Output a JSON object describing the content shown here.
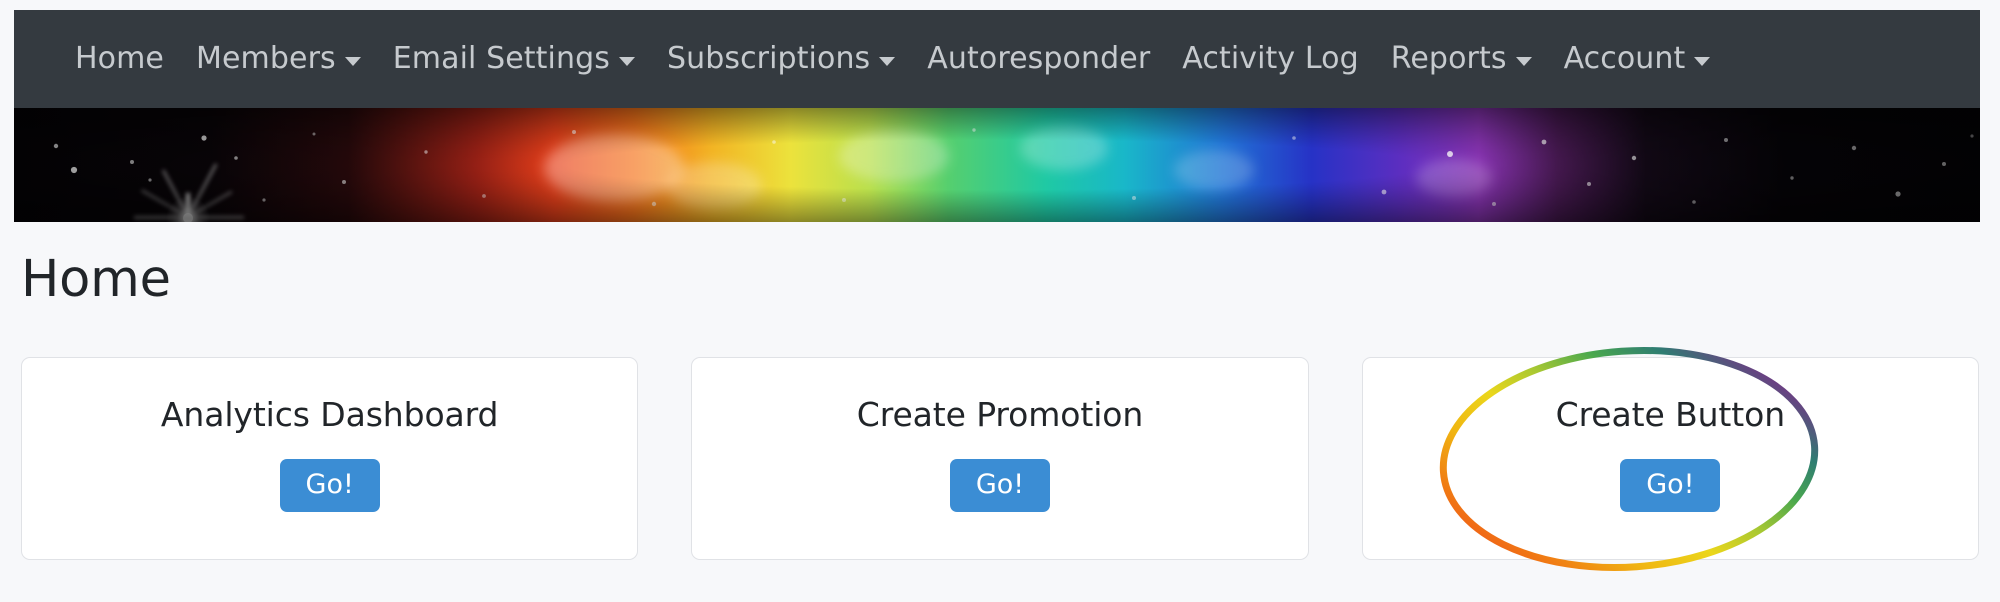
{
  "navbar": {
    "background_color": "#343a40",
    "text_color": "#c6cace",
    "items": [
      {
        "label": "Home",
        "has_caret": false,
        "name": "nav-item-home"
      },
      {
        "label": "Members",
        "has_caret": true,
        "name": "nav-item-members"
      },
      {
        "label": "Email Settings",
        "has_caret": true,
        "name": "nav-item-email-settings"
      },
      {
        "label": "Subscriptions",
        "has_caret": true,
        "name": "nav-item-subscriptions"
      },
      {
        "label": "Autoresponder",
        "has_caret": false,
        "name": "nav-item-autoresponder"
      },
      {
        "label": "Activity Log",
        "has_caret": false,
        "name": "nav-item-activity-log"
      },
      {
        "label": "Reports",
        "has_caret": true,
        "name": "nav-item-reports"
      },
      {
        "label": "Account",
        "has_caret": true,
        "name": "nav-item-account"
      }
    ]
  },
  "banner": {
    "description": "space nebula rainbow banner image"
  },
  "main": {
    "page_title": "Home",
    "cards": [
      {
        "title": "Analytics Dashboard",
        "button_label": "Go!",
        "annotated": false
      },
      {
        "title": "Create Promotion",
        "button_label": "Go!",
        "annotated": false
      },
      {
        "title": "Create Button",
        "button_label": "Go!",
        "annotated": true
      }
    ]
  },
  "colors": {
    "page_background": "#f7f8fa",
    "card_background": "#ffffff",
    "card_border": "#e0e2e6",
    "button_blue": "#3b8dd4",
    "title_color": "#212529",
    "annotation_stroke_start": "#e8601c",
    "annotation_stroke_mid": "#f2c200",
    "annotation_stroke_end": "#7b3f8c"
  }
}
